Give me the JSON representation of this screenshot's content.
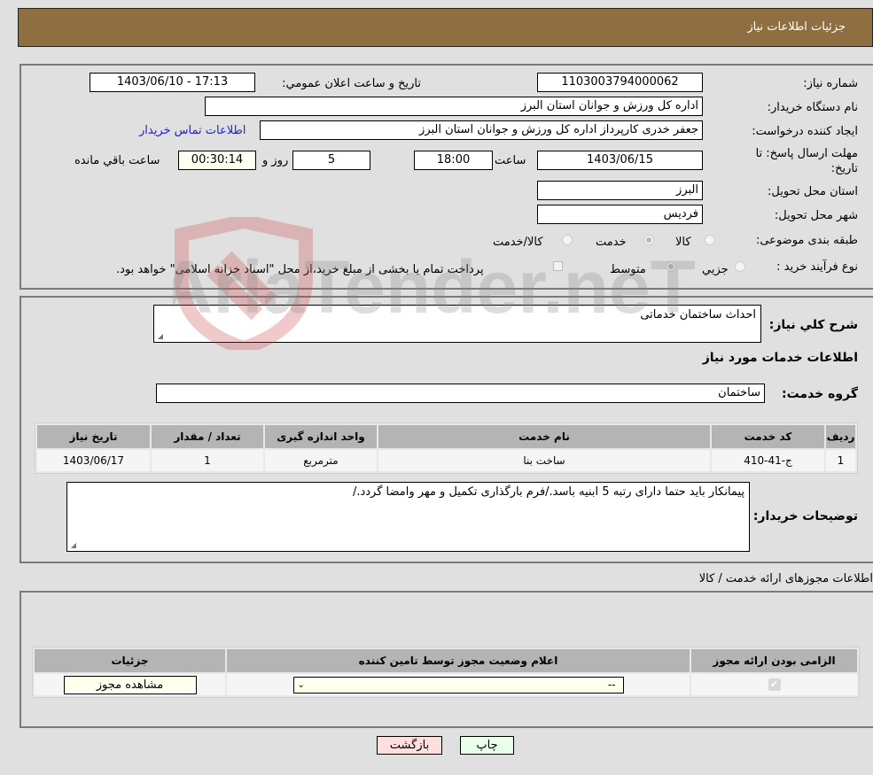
{
  "header": {
    "title": "جزئیات اطلاعات نیاز"
  },
  "form": {
    "need_number_label": "شماره نیاز:",
    "need_number": "1103003794000062",
    "announce_label": "تاريخ و ساعت اعلان عمومي:",
    "announce_value": "1403/06/10 - 17:13",
    "buyer_org_label": "نام دستگاه خریدار:",
    "buyer_org": "اداره کل ورزش و جوانان استان البرز",
    "creator_label": "ایجاد کننده درخواست:",
    "creator": "جعفر خدری کارپرداز اداره کل ورزش و جوانان استان البرز",
    "contact_link": "اطلاعات تماس خریدار",
    "deadline_label_line1": "مهلت ارسال پاسخ: تا",
    "deadline_label_line2": "تاریخ:",
    "deadline_date": "1403/06/15",
    "time_label": "ساعت",
    "deadline_time": "18:00",
    "days_value": "5",
    "days_label": "روز و",
    "remaining_time": "00:30:14",
    "remaining_label": "ساعت باقي مانده",
    "province_label": "استان محل تحویل:",
    "province": "البرز",
    "city_label": "شهر محل تحویل:",
    "city": "فردیس",
    "category_label": "طبقه بندی موضوعی:",
    "category_options": [
      "کالا",
      "خدمت",
      "کالا/خدمت"
    ],
    "category_selected": "خدمت",
    "process_label": "نوع فرآیند خرید :",
    "process_options": [
      "جزيي",
      "متوسط"
    ],
    "process_selected": "متوسط",
    "treasury_note": "پرداخت تمام یا بخشی از مبلغ خرید،از محل \"اسناد خزانه اسلامی\" خواهد بود."
  },
  "details": {
    "summary_label": "شرح کلي نياز:",
    "summary": "احداث ساختمان خدماتی",
    "services_title": "اطلاعات خدمات مورد نیاز",
    "service_group_label": "گروه خدمت:",
    "service_group": "ساختمان",
    "table": {
      "headers": [
        "ردیف",
        "کد خدمت",
        "نام خدمت",
        "واحد اندازه گیری",
        "تعداد / مقدار",
        "تاریخ نیاز"
      ],
      "rows": [
        [
          "1",
          "ج-41-410",
          "ساخت بنا",
          "مترمربع",
          "1",
          "1403/06/17"
        ]
      ]
    },
    "buyer_notes_label": "توضیحات خریدار:",
    "buyer_notes": "پیمانکار باید حتما دارای رتبه 5 ابنیه باسد./فرم بارگذاری تکمیل و مهر وامضا گردد./"
  },
  "permits": {
    "section_title": "اطلاعات مجوزهای ارائه خدمت / کالا",
    "headers": [
      "الزامی بودن ارائه مجوز",
      "اعلام وضعیت مجوز توسط تامین کننده",
      "جزئیات"
    ],
    "row": {
      "required_checked": true,
      "status_select": "--",
      "details_button": "مشاهده مجوز"
    }
  },
  "footer": {
    "print_button": "چاپ",
    "back_button": "بازگشت"
  },
  "watermark": {
    "text": "AriaTender.neT"
  }
}
